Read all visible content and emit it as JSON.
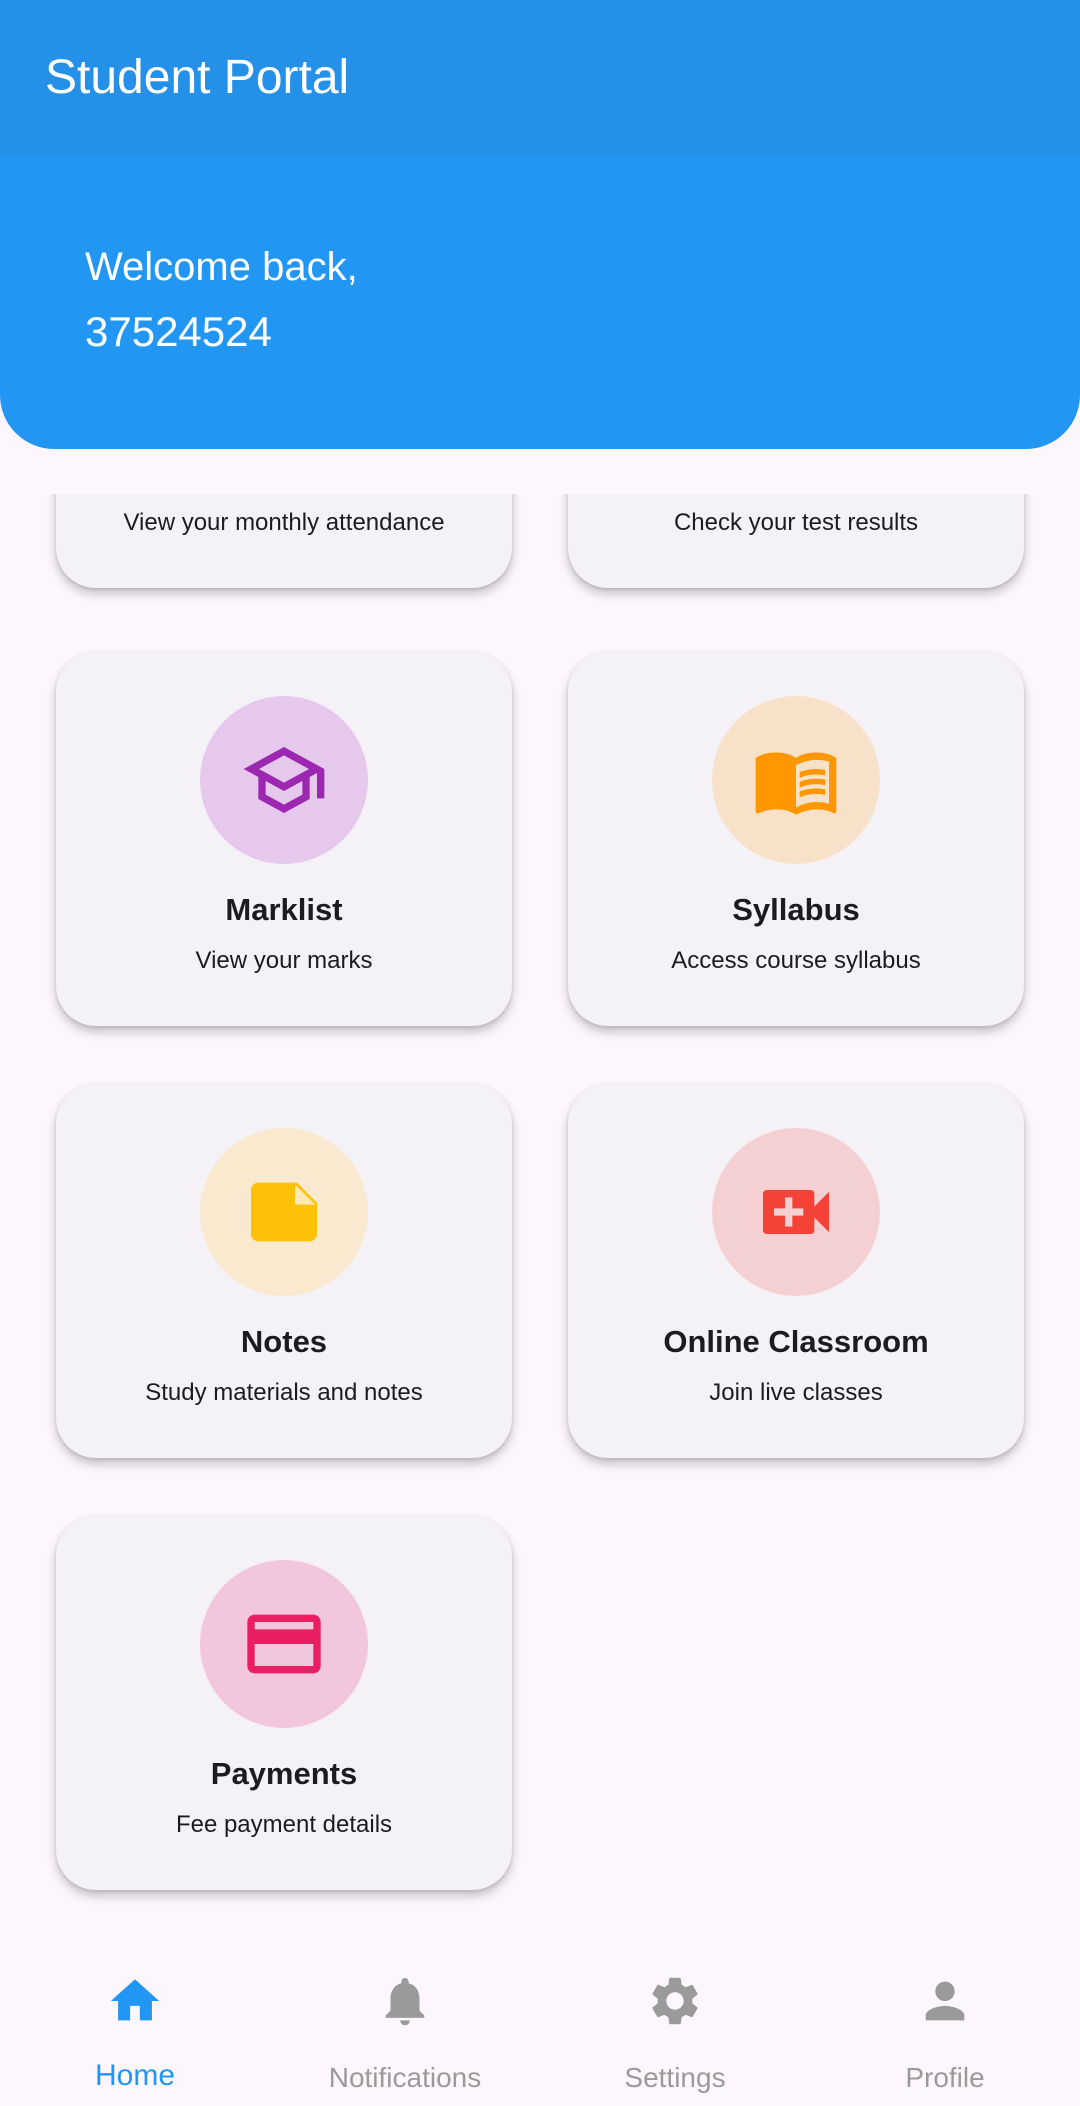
{
  "app_bar": {
    "title": "Student Portal"
  },
  "welcome": {
    "greeting": "Welcome back,",
    "student_id": "37524524"
  },
  "cards": [
    {
      "title": "",
      "subtitle": "View your monthly attendance",
      "icon": "attendance-icon"
    },
    {
      "title": "",
      "subtitle": "Check your test results",
      "icon": "test-results-icon"
    },
    {
      "title": "Marklist",
      "subtitle": "View your marks",
      "icon": "graduation-cap-icon",
      "icon_color": "#9c27b0",
      "circle_color": "#e5c8eb"
    },
    {
      "title": "Syllabus",
      "subtitle": "Access course syllabus",
      "icon": "book-icon",
      "icon_color": "#ff9800",
      "circle_color": "#f8e1c9"
    },
    {
      "title": "Notes",
      "subtitle": "Study materials and notes",
      "icon": "note-icon",
      "icon_color": "#ffc107",
      "circle_color": "#f8e9cf"
    },
    {
      "title": "Online Classroom",
      "subtitle": "Join live classes",
      "icon": "video-call-icon",
      "icon_color": "#f44336",
      "circle_color": "#f5d0d3"
    },
    {
      "title": "Payments",
      "subtitle": "Fee payment details",
      "icon": "credit-card-icon",
      "icon_color": "#e91e63",
      "circle_color": "#f2c6dc"
    }
  ],
  "bottom_nav": [
    {
      "label": "Home",
      "icon": "home-icon",
      "active": true
    },
    {
      "label": "Notifications",
      "icon": "bell-icon",
      "active": false
    },
    {
      "label": "Settings",
      "icon": "gear-icon",
      "active": false
    },
    {
      "label": "Profile",
      "icon": "person-icon",
      "active": false
    }
  ],
  "colors": {
    "app_bar": "#2590e8",
    "banner": "#2196f3",
    "active_nav": "#2196f3",
    "inactive_nav": "#9a9a9a"
  }
}
